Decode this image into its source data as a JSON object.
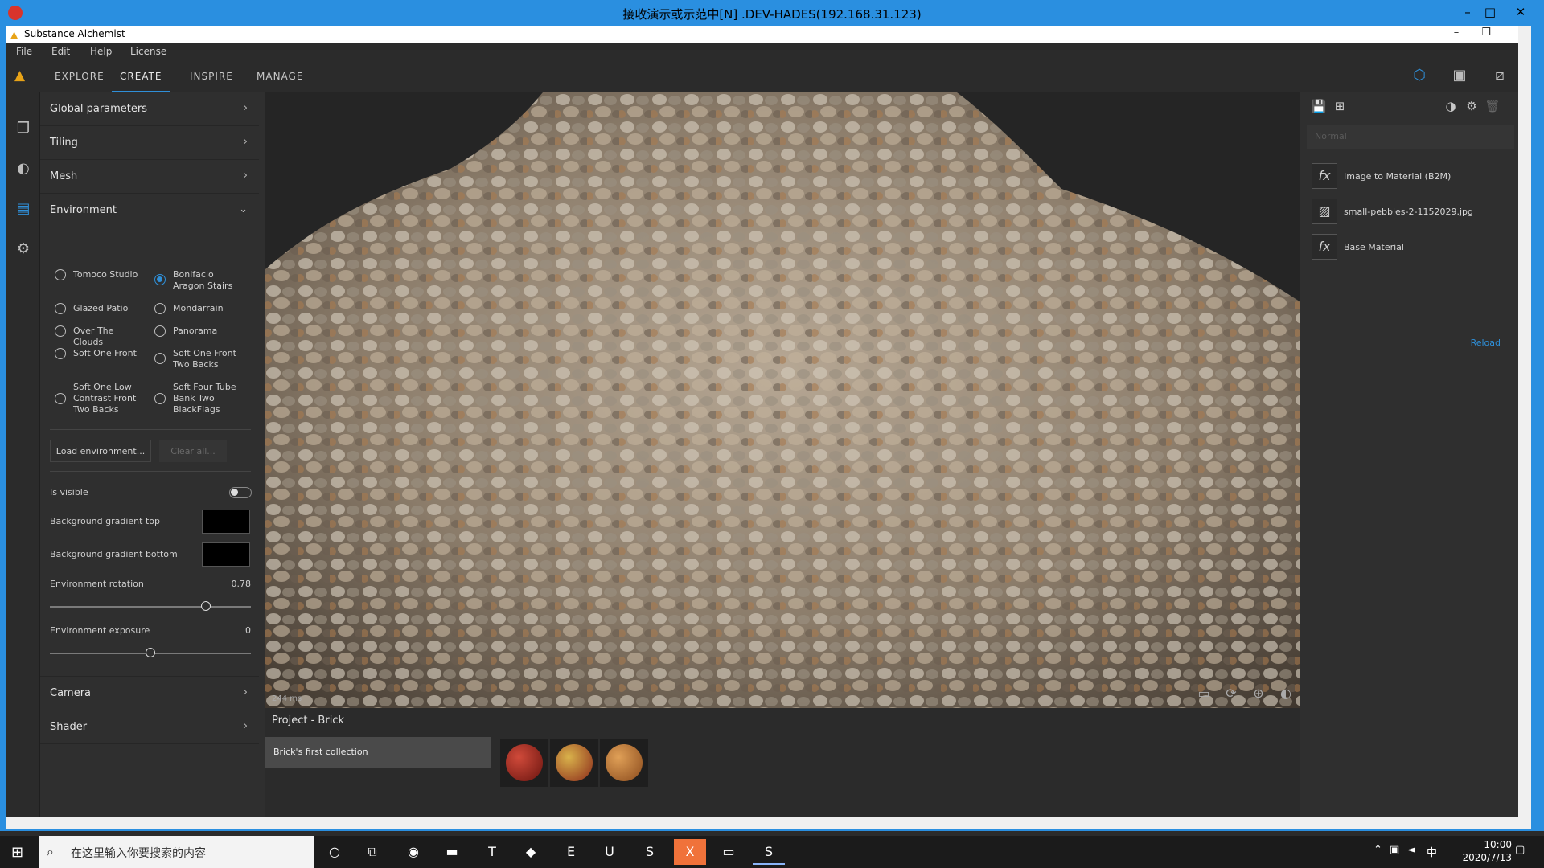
{
  "remote": {
    "title": "接收演示或示范中[N] .DEV-HADES(192.168.31.123)",
    "minimize": "–",
    "maximize": "□",
    "close": "✕"
  },
  "app": {
    "title": "Substance Alchemist",
    "minimize": "–",
    "restore": "❐",
    "close": "✕"
  },
  "menu": {
    "file": "File",
    "edit": "Edit",
    "help": "Help",
    "license": "License"
  },
  "nav": {
    "tabs": [
      "EXPLORE",
      "CREATE",
      "INSPIRE",
      "MANAGE"
    ],
    "active": "CREATE"
  },
  "left_panel": {
    "sections": {
      "global": "Global parameters",
      "tiling": "Tiling",
      "mesh": "Mesh",
      "environment": "Environment",
      "camera": "Camera",
      "shader": "Shader"
    },
    "environments": [
      "Tomoco Studio",
      "Bonifacio Aragon Stairs",
      "Glazed Patio",
      "Mondarrain",
      "Over The Clouds",
      "Panorama",
      "Soft One Front",
      "Soft One Front Two Backs",
      "Soft One Low Contrast Front Two Backs",
      "Soft Four Tube Bank Two BlackFlags"
    ],
    "selected_environment": "Bonifacio Aragon Stairs",
    "load_button": "Load environment...",
    "clear_button": "Clear all...",
    "is_visible_label": "Is visible",
    "is_visible": false,
    "bg_top_label": "Background gradient top",
    "bg_top_color": "#000000",
    "bg_bottom_label": "Background gradient bottom",
    "bg_bottom_color": "#000000",
    "rotation_label": "Environment rotation",
    "rotation_value": "0.78",
    "exposure_label": "Environment exposure",
    "exposure_value": "0"
  },
  "viewport": {
    "render_time": "244 ms"
  },
  "project": {
    "title": "Project - Brick",
    "collection": "Brick's first collection",
    "thumbnails": [
      {
        "name": "red-material",
        "color": "#8b1d1a"
      },
      {
        "name": "mixed-material",
        "color": "#9a6a2a"
      },
      {
        "name": "orange-material",
        "color": "#b8702f"
      }
    ]
  },
  "right_panel": {
    "blend_mode": "Normal",
    "layers": [
      {
        "icon": "fx",
        "name": "Image to Material (B2M)"
      },
      {
        "icon": "image",
        "name": "small-pebbles-2-1152029.jpg"
      },
      {
        "icon": "fx",
        "name": "Base Material"
      }
    ],
    "reload": "Reload"
  },
  "taskbar": {
    "search_placeholder": "在这里输入你要搜索的内容",
    "time": "10:00",
    "date": "2020/7/13",
    "ime": "中"
  },
  "colors": {
    "accent": "#2f8fd8",
    "logo": "#e8a317",
    "titlebar": "#2a8fe0"
  }
}
